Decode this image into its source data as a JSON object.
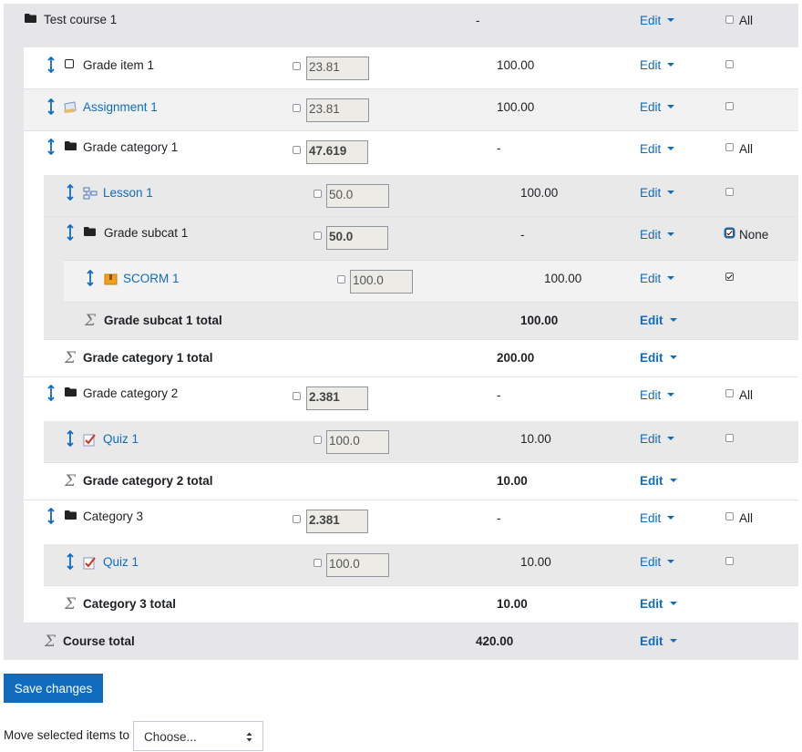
{
  "course": {
    "name": "Test course 1",
    "weight": "-",
    "edit": "Edit",
    "select": "All"
  },
  "rows": {
    "gi1": {
      "name": "Grade item 1",
      "weight": "23.81",
      "max": "100.00",
      "edit": "Edit"
    },
    "as1": {
      "name": "Assignment 1",
      "weight": "23.81",
      "max": "100.00",
      "edit": "Edit"
    },
    "gc1": {
      "name": "Grade category 1",
      "weight": "47.619",
      "max": "-",
      "edit": "Edit",
      "select": "All"
    },
    "ls1": {
      "name": "Lesson 1",
      "weight": "50.0",
      "max": "100.00",
      "edit": "Edit"
    },
    "sc1": {
      "name": "Grade subcat 1",
      "weight": "50.0",
      "max": "-",
      "edit": "Edit",
      "select": "None"
    },
    "scorm": {
      "name": "SCORM 1",
      "weight": "100.0",
      "max": "100.00",
      "edit": "Edit"
    },
    "sc1t": {
      "name": "Grade subcat 1 total",
      "max": "100.00",
      "edit": "Edit"
    },
    "gc1t": {
      "name": "Grade category 1 total",
      "max": "200.00",
      "edit": "Edit"
    },
    "gc2": {
      "name": "Grade category 2",
      "weight": "2.381",
      "max": "-",
      "edit": "Edit",
      "select": "All"
    },
    "qz1": {
      "name": "Quiz 1",
      "weight": "100.0",
      "max": "10.00",
      "edit": "Edit"
    },
    "gc2t": {
      "name": "Grade category 2 total",
      "max": "10.00",
      "edit": "Edit"
    },
    "c3": {
      "name": "Category 3",
      "weight": "2.381",
      "max": "-",
      "edit": "Edit",
      "select": "All"
    },
    "qz2": {
      "name": "Quiz 1",
      "weight": "100.0",
      "max": "10.00",
      "edit": "Edit"
    },
    "c3t": {
      "name": "Category 3 total",
      "max": "10.00",
      "edit": "Edit"
    },
    "ct": {
      "name": "Course total",
      "max": "420.00",
      "edit": "Edit"
    }
  },
  "footer": {
    "save_label": "Save changes",
    "move_label": "Move selected items to",
    "move_select": "Choose..."
  },
  "colors": {
    "link": "#0f6cbf",
    "button": "#0f6cbf",
    "row_shade": "#e9e9ea"
  }
}
